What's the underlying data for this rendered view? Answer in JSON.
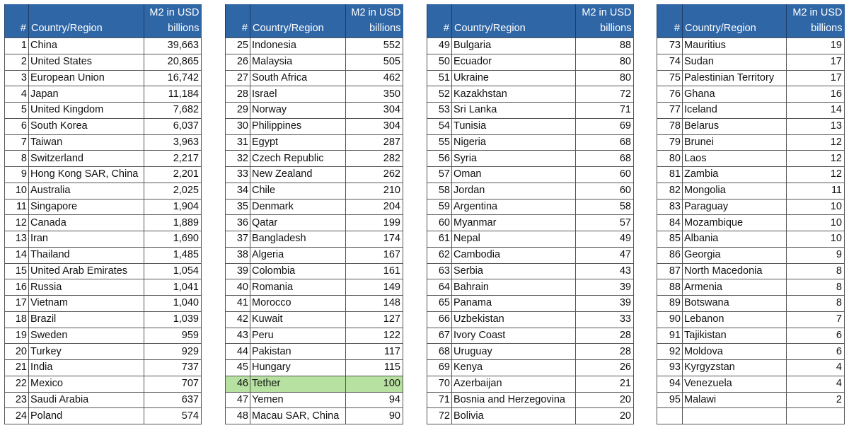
{
  "header": {
    "rank": "#",
    "name": "Country/Region",
    "value_line1": "M2 in USD",
    "value_line2": "billions"
  },
  "highlight_color": "#B7E1A1",
  "header_color": "#2F66A6",
  "tables": [
    {
      "rows": [
        {
          "rank": "1",
          "name": "China",
          "value": "39,663"
        },
        {
          "rank": "2",
          "name": "United States",
          "value": "20,865"
        },
        {
          "rank": "3",
          "name": "European Union",
          "value": "16,742"
        },
        {
          "rank": "4",
          "name": "Japan",
          "value": "11,184"
        },
        {
          "rank": "5",
          "name": "United Kingdom",
          "value": "7,682"
        },
        {
          "rank": "6",
          "name": "South Korea",
          "value": "6,037"
        },
        {
          "rank": "7",
          "name": "Taiwan",
          "value": "3,963"
        },
        {
          "rank": "8",
          "name": "Switzerland",
          "value": "2,217"
        },
        {
          "rank": "9",
          "name": "Hong Kong SAR, China",
          "value": "2,201"
        },
        {
          "rank": "10",
          "name": "Australia",
          "value": "2,025"
        },
        {
          "rank": "11",
          "name": "Singapore",
          "value": "1,904"
        },
        {
          "rank": "12",
          "name": "Canada",
          "value": "1,889"
        },
        {
          "rank": "13",
          "name": "Iran",
          "value": "1,690"
        },
        {
          "rank": "14",
          "name": "Thailand",
          "value": "1,485"
        },
        {
          "rank": "15",
          "name": "United Arab Emirates",
          "value": "1,054"
        },
        {
          "rank": "16",
          "name": "Russia",
          "value": "1,041"
        },
        {
          "rank": "17",
          "name": "Vietnam",
          "value": "1,040"
        },
        {
          "rank": "18",
          "name": "Brazil",
          "value": "1,039"
        },
        {
          "rank": "19",
          "name": "Sweden",
          "value": "959"
        },
        {
          "rank": "20",
          "name": "Turkey",
          "value": "929"
        },
        {
          "rank": "21",
          "name": "India",
          "value": "737"
        },
        {
          "rank": "22",
          "name": "Mexico",
          "value": "707"
        },
        {
          "rank": "23",
          "name": "Saudi Arabia",
          "value": "637"
        },
        {
          "rank": "24",
          "name": "Poland",
          "value": "574"
        }
      ]
    },
    {
      "rows": [
        {
          "rank": "25",
          "name": "Indonesia",
          "value": "552"
        },
        {
          "rank": "26",
          "name": "Malaysia",
          "value": "505"
        },
        {
          "rank": "27",
          "name": "South Africa",
          "value": "462"
        },
        {
          "rank": "28",
          "name": "Israel",
          "value": "350"
        },
        {
          "rank": "29",
          "name": "Norway",
          "value": "304"
        },
        {
          "rank": "30",
          "name": "Philippines",
          "value": "304"
        },
        {
          "rank": "31",
          "name": "Egypt",
          "value": "287"
        },
        {
          "rank": "32",
          "name": "Czech Republic",
          "value": "282"
        },
        {
          "rank": "33",
          "name": "New Zealand",
          "value": "262"
        },
        {
          "rank": "34",
          "name": "Chile",
          "value": "210"
        },
        {
          "rank": "35",
          "name": "Denmark",
          "value": "204"
        },
        {
          "rank": "36",
          "name": "Qatar",
          "value": "199"
        },
        {
          "rank": "37",
          "name": "Bangladesh",
          "value": "174"
        },
        {
          "rank": "38",
          "name": "Algeria",
          "value": "167"
        },
        {
          "rank": "39",
          "name": "Colombia",
          "value": "161"
        },
        {
          "rank": "40",
          "name": "Romania",
          "value": "149"
        },
        {
          "rank": "41",
          "name": "Morocco",
          "value": "148"
        },
        {
          "rank": "42",
          "name": "Kuwait",
          "value": "127"
        },
        {
          "rank": "43",
          "name": "Peru",
          "value": "122"
        },
        {
          "rank": "44",
          "name": "Pakistan",
          "value": "117"
        },
        {
          "rank": "45",
          "name": "Hungary",
          "value": "115"
        },
        {
          "rank": "46",
          "name": "Tether",
          "value": "100",
          "highlighted": true
        },
        {
          "rank": "47",
          "name": "Yemen",
          "value": "94"
        },
        {
          "rank": "48",
          "name": "Macau SAR, China",
          "value": "90"
        }
      ]
    },
    {
      "rows": [
        {
          "rank": "49",
          "name": "Bulgaria",
          "value": "88"
        },
        {
          "rank": "50",
          "name": "Ecuador",
          "value": "80"
        },
        {
          "rank": "51",
          "name": "Ukraine",
          "value": "80"
        },
        {
          "rank": "52",
          "name": "Kazakhstan",
          "value": "72"
        },
        {
          "rank": "53",
          "name": "Sri Lanka",
          "value": "71"
        },
        {
          "rank": "54",
          "name": "Tunisia",
          "value": "69"
        },
        {
          "rank": "55",
          "name": "Nigeria",
          "value": "68"
        },
        {
          "rank": "56",
          "name": "Syria",
          "value": "68"
        },
        {
          "rank": "57",
          "name": "Oman",
          "value": "60"
        },
        {
          "rank": "58",
          "name": "Jordan",
          "value": "60"
        },
        {
          "rank": "59",
          "name": "Argentina",
          "value": "58"
        },
        {
          "rank": "60",
          "name": "Myanmar",
          "value": "57"
        },
        {
          "rank": "61",
          "name": "Nepal",
          "value": "49"
        },
        {
          "rank": "62",
          "name": "Cambodia",
          "value": "47"
        },
        {
          "rank": "63",
          "name": "Serbia",
          "value": "43"
        },
        {
          "rank": "64",
          "name": "Bahrain",
          "value": "39"
        },
        {
          "rank": "65",
          "name": "Panama",
          "value": "39"
        },
        {
          "rank": "66",
          "name": "Uzbekistan",
          "value": "33"
        },
        {
          "rank": "67",
          "name": "Ivory Coast",
          "value": "28"
        },
        {
          "rank": "68",
          "name": "Uruguay",
          "value": "28"
        },
        {
          "rank": "69",
          "name": "Kenya",
          "value": "26"
        },
        {
          "rank": "70",
          "name": "Azerbaijan",
          "value": "21"
        },
        {
          "rank": "71",
          "name": "Bosnia and Herzegovina",
          "value": "20"
        },
        {
          "rank": "72",
          "name": "Bolivia",
          "value": "20"
        }
      ]
    },
    {
      "rows": [
        {
          "rank": "73",
          "name": "Mauritius",
          "value": "19"
        },
        {
          "rank": "74",
          "name": "Sudan",
          "value": "17"
        },
        {
          "rank": "75",
          "name": "Palestinian Territory",
          "value": "17"
        },
        {
          "rank": "76",
          "name": "Ghana",
          "value": "16"
        },
        {
          "rank": "77",
          "name": "Iceland",
          "value": "14"
        },
        {
          "rank": "78",
          "name": "Belarus",
          "value": "13"
        },
        {
          "rank": "79",
          "name": "Brunei",
          "value": "12"
        },
        {
          "rank": "80",
          "name": "Laos",
          "value": "12"
        },
        {
          "rank": "81",
          "name": "Zambia",
          "value": "12"
        },
        {
          "rank": "82",
          "name": "Mongolia",
          "value": "11"
        },
        {
          "rank": "83",
          "name": "Paraguay",
          "value": "10"
        },
        {
          "rank": "84",
          "name": "Mozambique",
          "value": "10"
        },
        {
          "rank": "85",
          "name": "Albania",
          "value": "10"
        },
        {
          "rank": "86",
          "name": "Georgia",
          "value": "9"
        },
        {
          "rank": "87",
          "name": "North Macedonia",
          "value": "8"
        },
        {
          "rank": "88",
          "name": "Armenia",
          "value": "8"
        },
        {
          "rank": "89",
          "name": "Botswana",
          "value": "8"
        },
        {
          "rank": "90",
          "name": "Lebanon",
          "value": "7"
        },
        {
          "rank": "91",
          "name": "Tajikistan",
          "value": "6"
        },
        {
          "rank": "92",
          "name": "Moldova",
          "value": "6"
        },
        {
          "rank": "93",
          "name": "Kyrgyzstan",
          "value": "4"
        },
        {
          "rank": "94",
          "name": "Venezuela",
          "value": "4"
        },
        {
          "rank": "95",
          "name": "Malawi",
          "value": "2"
        }
      ]
    }
  ]
}
